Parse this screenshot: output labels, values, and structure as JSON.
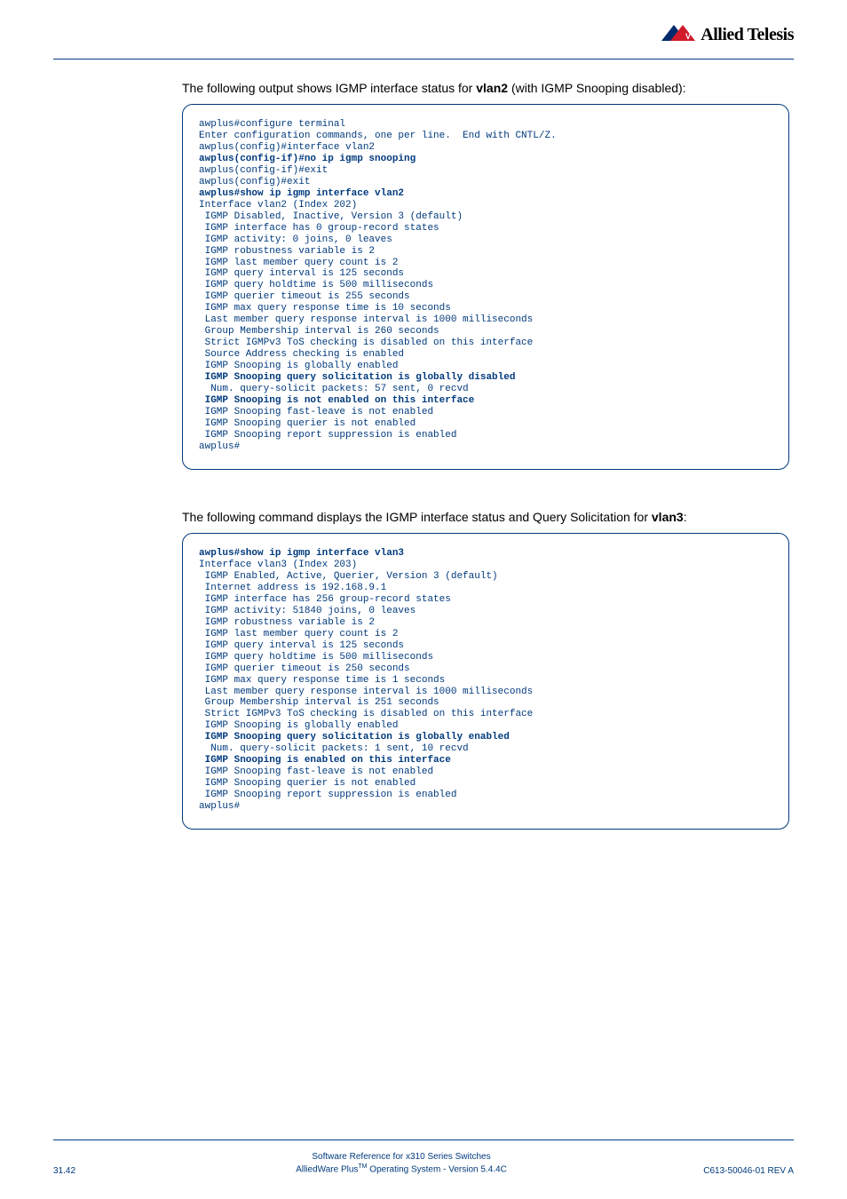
{
  "header": {
    "brand": "Allied Telesis"
  },
  "intro1_a": "The following output shows IGMP interface status for ",
  "intro1_bold": "vlan2",
  "intro1_b": " (with IGMP Snooping disabled):",
  "terminal1": {
    "l1": "awplus#configure terminal",
    "l2": "Enter configuration commands, one per line.  End with CNTL/Z.",
    "l3": "awplus(config)#interface vlan2",
    "l4": "awplus(config-if)#no ip igmp snooping",
    "l5": "awplus(config-if)#exit",
    "l6": "awplus(config)#exit",
    "l7": "awplus#show ip igmp interface vlan2",
    "l8": "Interface vlan2 (Index 202)",
    "l9": " IGMP Disabled, Inactive, Version 3 (default)",
    "l10": " IGMP interface has 0 group-record states",
    "l11": " IGMP activity: 0 joins, 0 leaves",
    "l12": " IGMP robustness variable is 2",
    "l13": " IGMP last member query count is 2",
    "l14": " IGMP query interval is 125 seconds",
    "l15": " IGMP query holdtime is 500 milliseconds",
    "l16": " IGMP querier timeout is 255 seconds",
    "l17": " IGMP max query response time is 10 seconds",
    "l18": " Last member query response interval is 1000 milliseconds",
    "l19": " Group Membership interval is 260 seconds",
    "l20": " Strict IGMPv3 ToS checking is disabled on this interface",
    "l21": " Source Address checking is enabled",
    "l22": " IGMP Snooping is globally enabled",
    "l23": " IGMP Snooping query solicitation is globally disabled",
    "l24": "  Num. query-solicit packets: 57 sent, 0 recvd",
    "l25": " IGMP Snooping is not enabled on this interface",
    "l26": " IGMP Snooping fast-leave is not enabled",
    "l27": " IGMP Snooping querier is not enabled",
    "l28": " IGMP Snooping report suppression is enabled",
    "l29": "awplus#"
  },
  "intro2_a": "The following command displays the IGMP interface status and Query Solicitation for ",
  "intro2_bold": "vlan3",
  "intro2_b": ":",
  "terminal2": {
    "l1": "awplus#show ip igmp interface vlan3",
    "l2": "Interface vlan3 (Index 203)",
    "l3": " IGMP Enabled, Active, Querier, Version 3 (default)",
    "l4": " Internet address is 192.168.9.1",
    "l5": " IGMP interface has 256 group-record states",
    "l6": " IGMP activity: 51840 joins, 0 leaves",
    "l7": " IGMP robustness variable is 2",
    "l8": " IGMP last member query count is 2",
    "l9": " IGMP query interval is 125 seconds",
    "l10": " IGMP query holdtime is 500 milliseconds",
    "l11": " IGMP querier timeout is 250 seconds",
    "l12": " IGMP max query response time is 1 seconds",
    "l13": " Last member query response interval is 1000 milliseconds",
    "l14": " Group Membership interval is 251 seconds",
    "l15": " Strict IGMPv3 ToS checking is disabled on this interface",
    "l16": " IGMP Snooping is globally enabled",
    "l17": " IGMP Snooping query solicitation is globally enabled",
    "l18": "  Num. query-solicit packets: 1 sent, 10 recvd",
    "l19": " IGMP Snooping is enabled on this interface",
    "l20": " IGMP Snooping fast-leave is not enabled",
    "l21": " IGMP Snooping querier is not enabled",
    "l22": " IGMP Snooping report suppression is enabled",
    "l23": "awplus#"
  },
  "footer": {
    "page": "31.42",
    "line1": "Software Reference for x310 Series Switches",
    "line2a": "AlliedWare Plus",
    "line2tm": "TM",
    "line2b": " Operating System  - Version 5.4.4C",
    "rev": "C613-50046-01 REV A"
  }
}
